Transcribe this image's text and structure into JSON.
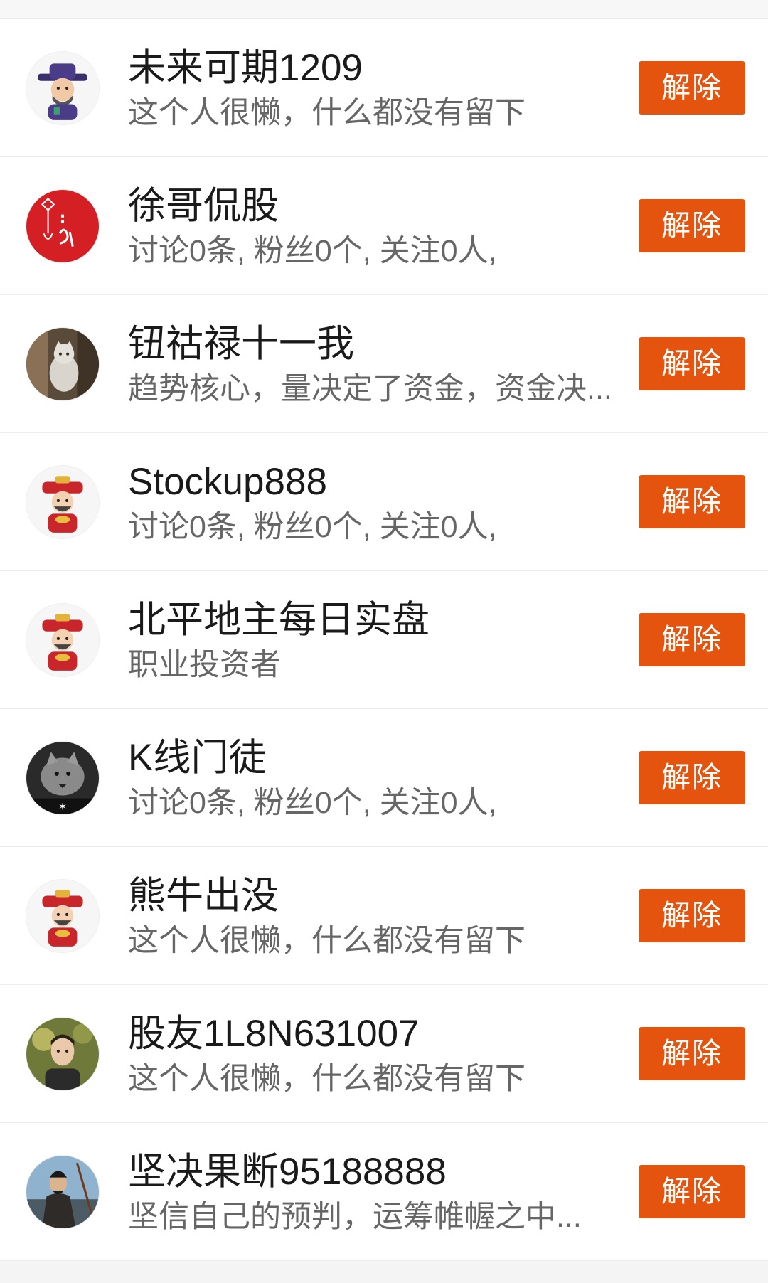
{
  "colors": {
    "accent": "#e5540f",
    "name_text": "#1a1a1a",
    "bio_text": "#666666",
    "divider": "#ececec",
    "background": "#f4f4f4"
  },
  "list": {
    "items": [
      {
        "name": "未来可期1209",
        "bio": "这个人很懒，什么都没有留下",
        "button": "解除",
        "avatar_icon": "god-of-wealth-avatar"
      },
      {
        "name": "徐哥侃股",
        "bio": "讨论0条, 粉丝0个, 关注0人,",
        "button": "解除",
        "avatar_icon": "chinese-knot-avatar"
      },
      {
        "name": "钮祜禄十一我",
        "bio": "趋势核心，量决定了资金，资金决...",
        "button": "解除",
        "avatar_icon": "cat-photo-avatar"
      },
      {
        "name": "Stockup888",
        "bio": "讨论0条, 粉丝0个, 关注0人,",
        "button": "解除",
        "avatar_icon": "god-of-wealth-avatar"
      },
      {
        "name": "北平地主每日实盘",
        "bio": "职业投资者",
        "button": "解除",
        "avatar_icon": "god-of-wealth-avatar"
      },
      {
        "name": "K线门徒",
        "bio": "讨论0条, 粉丝0个, 关注0人,",
        "button": "解除",
        "avatar_icon": "wolf-photo-avatar"
      },
      {
        "name": "熊牛出没",
        "bio": "这个人很懒，什么都没有留下",
        "button": "解除",
        "avatar_icon": "god-of-wealth-avatar"
      },
      {
        "name": "股友1L8N631007",
        "bio": "这个人很懒，什么都没有留下",
        "button": "解除",
        "avatar_icon": "person-photo-avatar"
      },
      {
        "name": "坚决果断95188888",
        "bio": "坚信自己的预判，运筹帷幄之中...",
        "button": "解除",
        "avatar_icon": "warrior-photo-avatar"
      }
    ]
  }
}
